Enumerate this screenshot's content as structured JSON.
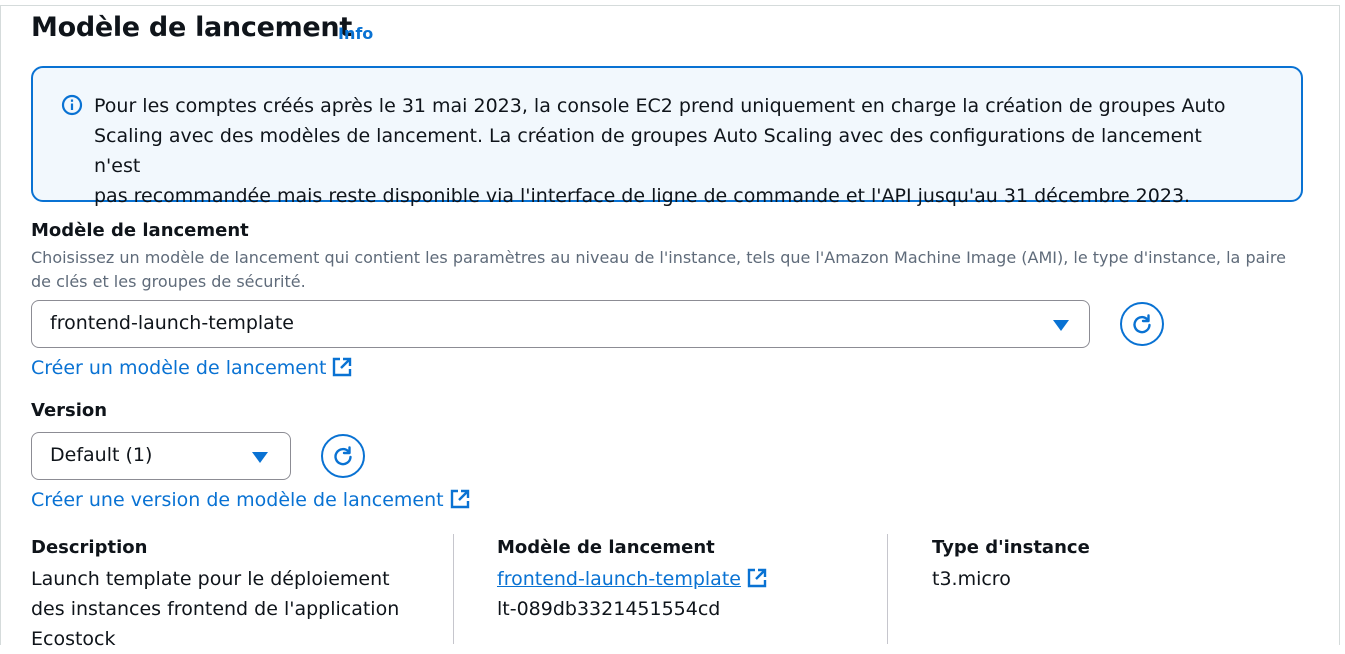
{
  "section": {
    "title": "Modèle de lancement",
    "info_link": "Info"
  },
  "alert": {
    "icon": "info-icon",
    "line1": "Pour les comptes créés après le 31 mai 2023, la console EC2 prend uniquement en charge la création de groupes Auto",
    "line2": "Scaling avec des modèles de lancement. La création de groupes Auto Scaling avec des configurations de lancement n'est",
    "line3": "pas recommandée mais reste disponible via l'interface de ligne de commande et l'API jusqu'au 31 décembre 2023."
  },
  "template_field": {
    "label": "Modèle de lancement",
    "description_line1": "Choisissez un modèle de lancement qui contient les paramètres au niveau de l'instance, tels que l'Amazon Machine Image (AMI), le type d'instance, la paire",
    "description_line2": "de clés et les groupes de sécurité.",
    "selected_value": "frontend-launch-template",
    "create_link": "Créer un modèle de lancement"
  },
  "version_field": {
    "label": "Version",
    "selected_value": "Default (1)",
    "create_link": "Créer une version de modèle de lancement"
  },
  "details": {
    "description": {
      "label": "Description",
      "line1": "Launch template pour le déploiement",
      "line2": "des instances frontend de l'application",
      "line3": "Ecostock"
    },
    "launch_template": {
      "label": "Modèle de lancement",
      "link": "frontend-launch-template",
      "id": "lt-089db3321451554cd"
    },
    "instance_type": {
      "label": "Type d'instance",
      "value": "t3.micro"
    }
  },
  "colors": {
    "accent": "#0972d3",
    "alert_bg": "#f2f8fd",
    "text": "#0f141a",
    "muted_text": "#5f6b7a"
  }
}
